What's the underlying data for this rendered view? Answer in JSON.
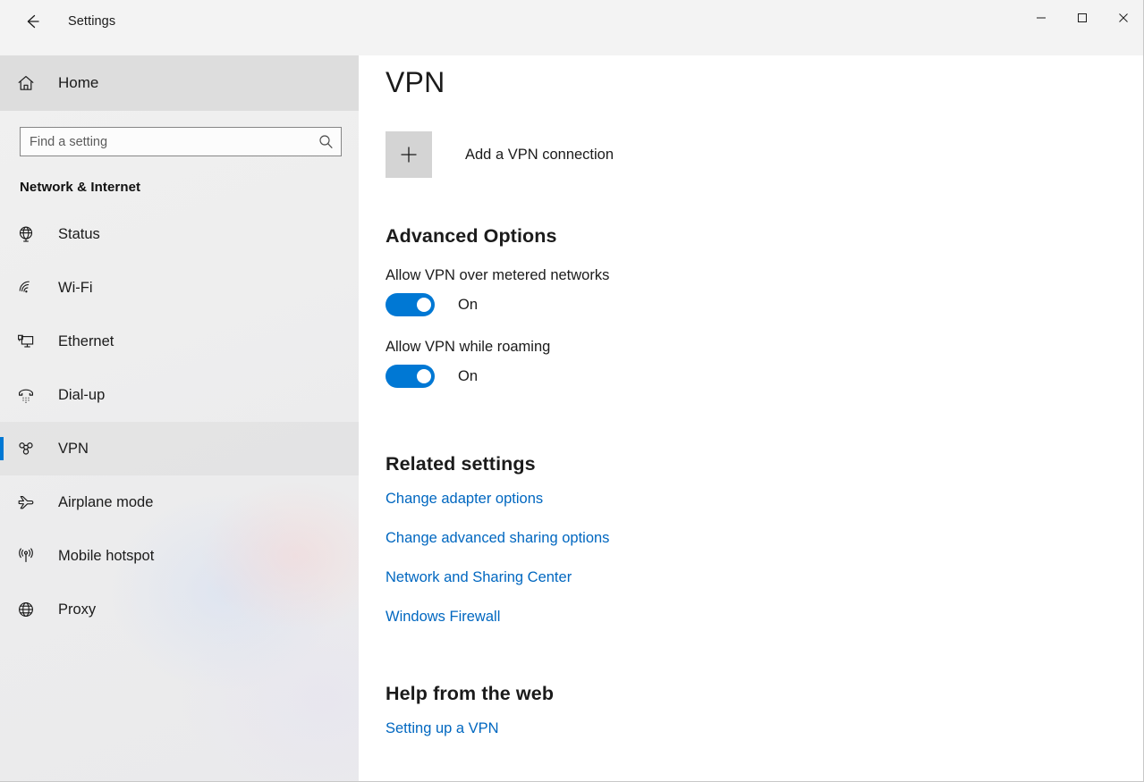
{
  "window": {
    "title": "Settings",
    "back_icon": "back-arrow-icon",
    "controls": {
      "minimize": "minimize-icon",
      "maximize": "maximize-icon",
      "close": "close-icon"
    }
  },
  "sidebar": {
    "home": {
      "label": "Home",
      "icon": "home-icon"
    },
    "search": {
      "placeholder": "Find a setting",
      "value": "",
      "icon": "search-icon"
    },
    "category": "Network & Internet",
    "items": [
      {
        "label": "Status",
        "icon": "globe-icon",
        "selected": false
      },
      {
        "label": "Wi-Fi",
        "icon": "wifi-icon",
        "selected": false
      },
      {
        "label": "Ethernet",
        "icon": "ethernet-icon",
        "selected": false
      },
      {
        "label": "Dial-up",
        "icon": "dialup-phone-icon",
        "selected": false
      },
      {
        "label": "VPN",
        "icon": "vpn-icon",
        "selected": true
      },
      {
        "label": "Airplane mode",
        "icon": "airplane-icon",
        "selected": false
      },
      {
        "label": "Mobile hotspot",
        "icon": "hotspot-icon",
        "selected": false
      },
      {
        "label": "Proxy",
        "icon": "globe-icon",
        "selected": false
      }
    ]
  },
  "main": {
    "page_title": "VPN",
    "add_connection": {
      "label": "Add a VPN connection",
      "icon": "plus-icon"
    },
    "advanced_options": {
      "heading": "Advanced Options",
      "toggles": [
        {
          "label": "Allow VPN over metered networks",
          "state": "On",
          "on": true
        },
        {
          "label": "Allow VPN while roaming",
          "state": "On",
          "on": true
        }
      ]
    },
    "related_settings": {
      "heading": "Related settings",
      "links": [
        "Change adapter options",
        "Change advanced sharing options",
        "Network and Sharing Center",
        "Windows Firewall"
      ]
    },
    "help_from_web": {
      "heading": "Help from the web",
      "links": [
        "Setting up a VPN"
      ]
    }
  },
  "colors": {
    "accent": "#0078d4",
    "link": "#0067c0",
    "sidebar_bg": "#eeeeee",
    "titlebar_bg": "#f3f3f3",
    "text": "#1b1b1b"
  }
}
